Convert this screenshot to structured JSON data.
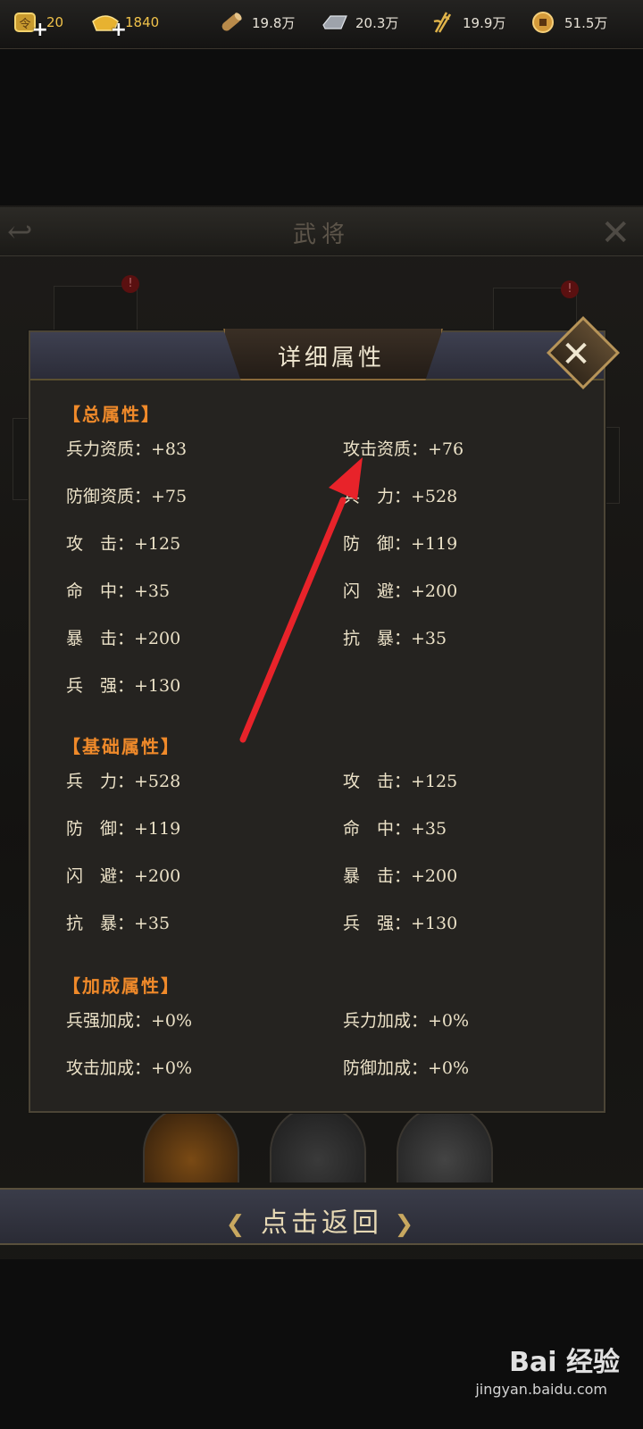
{
  "topbar": {
    "jade": {
      "value": "20",
      "icon": "jade-token-icon"
    },
    "gold": {
      "value": "1840",
      "icon": "gold-ingot-icon"
    },
    "wood": {
      "value": "19.8万",
      "icon": "wood-log-icon"
    },
    "iron": {
      "value": "20.3万",
      "icon": "iron-ingot-icon"
    },
    "grain": {
      "value": "19.9万",
      "icon": "grain-wheat-icon"
    },
    "copper": {
      "value": "51.5万",
      "icon": "copper-coin-icon"
    }
  },
  "scene": {
    "title": "武将",
    "alert_mark": "!"
  },
  "modal": {
    "title": "详细属性",
    "sections": [
      {
        "heading": "【总属性】",
        "rows": [
          [
            "兵力资质：+83",
            "攻击资质：+76"
          ],
          [
            "防御资质：+75",
            "兵　力：+528"
          ],
          [
            "攻　击：+125",
            "防　御：+119"
          ],
          [
            "命　中：+35",
            "闪　避：+200"
          ],
          [
            "暴　击：+200",
            "抗　暴：+35"
          ],
          [
            "兵　强：+130",
            ""
          ]
        ]
      },
      {
        "heading": "【基础属性】",
        "rows": [
          [
            "兵　力：+528",
            "攻　击：+125"
          ],
          [
            "防　御：+119",
            "命　中：+35"
          ],
          [
            "闪　避：+200",
            "暴　击：+200"
          ],
          [
            "抗　暴：+35",
            "兵　强：+130"
          ]
        ]
      },
      {
        "heading": "【加成属性】",
        "rows": [
          [
            "兵强加成：+0%",
            "兵力加成：+0%"
          ],
          [
            "攻击加成：+0%",
            "防御加成：+0%"
          ]
        ]
      }
    ]
  },
  "footer": {
    "return_label": "点击返回"
  },
  "watermark": {
    "brand": "Bai 经验",
    "url": "jingyan.baidu.com"
  },
  "colors": {
    "section_heading": "#f08a2a",
    "annotation_arrow": "#e8232a",
    "gold_value": "#f0c24a"
  }
}
